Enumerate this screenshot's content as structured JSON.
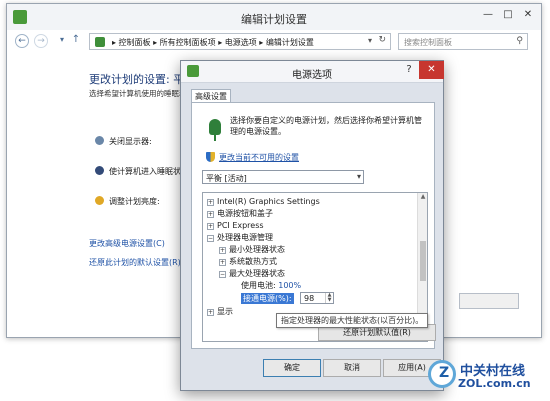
{
  "background_window": {
    "title": "编辑计划设置",
    "caption_buttons": [
      "—",
      "□",
      "✕"
    ],
    "nav": {
      "back_icon": "back-arrow-icon",
      "forward_icon": "forward-arrow-icon",
      "up_icon": "up-arrow-icon"
    },
    "address": {
      "segments": "▸ 控制面板 ▸ 所有控制面板项 ▸ 电源选项 ▸ 编辑计划设置",
      "dropdown": "▾",
      "refresh": "↻"
    },
    "search": {
      "placeholder": "搜索控制面板"
    },
    "heading": "更改计划的设置: 平衡",
    "description": "选择希望计算机使用的睡眠和显示设置。",
    "settings": [
      "关闭显示器:",
      "使计算机进入睡眠状态:",
      "调整计划亮度:"
    ],
    "links": {
      "advanced": "更改高级电源设置(C)",
      "restore": "还原此计划的默认设置(R)"
    }
  },
  "dialog": {
    "title": "电源选项",
    "help_label": "?",
    "close_label": "✕",
    "tab": "高级设置",
    "description": "选择你要自定义的电源计划，然后选择你希望计算机管理的电源设置。",
    "change_link": "更改当前不可用的设置",
    "plan_select": {
      "value": "平衡 [活动]",
      "arrow": "▾"
    },
    "tree": [
      {
        "pm": "+",
        "label": "Intel(R) Graphics Settings"
      },
      {
        "pm": "+",
        "label": "电源按钮和盖子"
      },
      {
        "pm": "+",
        "label": "PCI Express"
      },
      {
        "pm": "−",
        "label": "处理器电源管理"
      },
      {
        "pm": "+",
        "label": "最小处理器状态"
      },
      {
        "pm": "+",
        "label": "系统散热方式"
      },
      {
        "pm": "−",
        "label": "最大处理器状态"
      },
      {
        "pm": "+",
        "label": "显示"
      }
    ],
    "battery": {
      "label": "使用电池:",
      "value": "100%"
    },
    "ac": {
      "label": "接通电源(%):",
      "value": "98"
    },
    "tooltip": "指定处理器的最大性能状态(以百分比)。",
    "restore_button": "还原计划默认值(R)",
    "buttons": {
      "ok": "确定",
      "cancel": "取消",
      "apply": "应用(A)"
    }
  },
  "watermark": {
    "cn": "中关村在线",
    "en": "ZOL.com.cn"
  }
}
